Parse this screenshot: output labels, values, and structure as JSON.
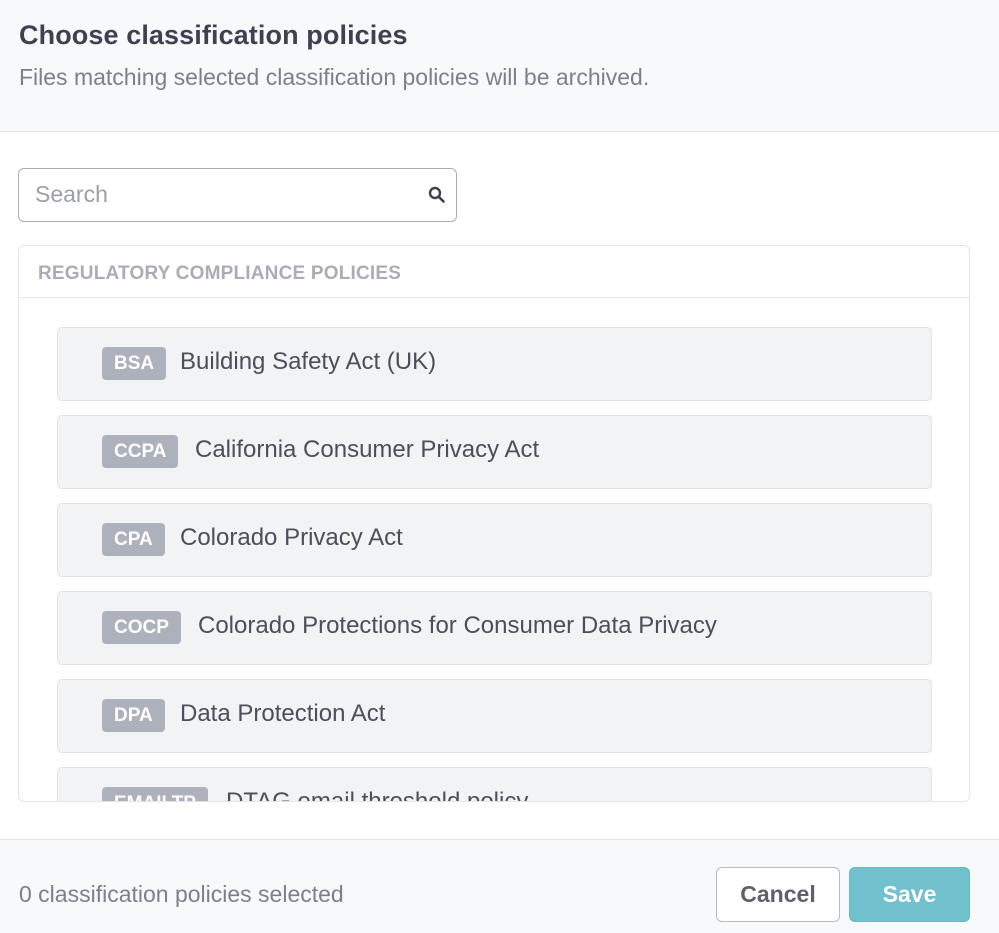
{
  "header": {
    "title": "Choose classification policies",
    "subtitle": "Files matching selected classification policies will be archived."
  },
  "search": {
    "placeholder": "Search",
    "value": ""
  },
  "group": {
    "label": "REGULATORY COMPLIANCE POLICIES",
    "items": [
      {
        "badge": "BSA",
        "label": "Building Safety Act (UK)"
      },
      {
        "badge": "CCPA",
        "label": "California Consumer Privacy Act"
      },
      {
        "badge": "CPA",
        "label": "Colorado Privacy Act"
      },
      {
        "badge": "COCP",
        "label": "Colorado Protections for Consumer Data Privacy"
      },
      {
        "badge": "DPA",
        "label": "Data Protection Act"
      },
      {
        "badge": "EMAILTP",
        "label": "DTAG email threshold policy"
      }
    ]
  },
  "footer": {
    "selected_text": "0 classification policies selected",
    "cancel_label": "Cancel",
    "save_label": "Save"
  },
  "colors": {
    "accent": "#70c1cd",
    "badge": "#acb1bb"
  },
  "icons": {
    "search": "search-icon"
  }
}
